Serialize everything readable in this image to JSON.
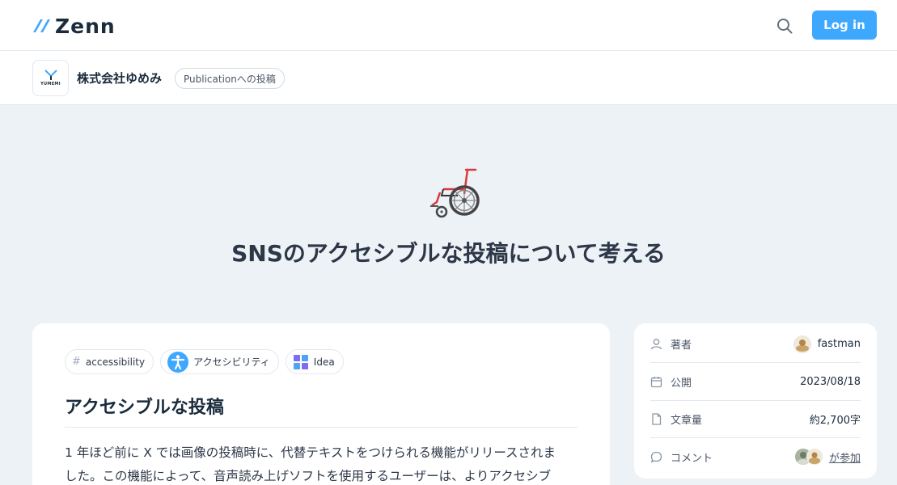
{
  "header": {
    "logo_text": "Zenn",
    "search_icon": "search-icon",
    "login_label": "Log in",
    "accent_color": "#3ea8ff"
  },
  "publication": {
    "logo_word": "YUMEMI",
    "name": "株式会社ゆめみ",
    "badge": "Publicationへの投稿"
  },
  "article": {
    "emoji_icon": "wheelchair-icon",
    "title": "SNSのアクセシブルな投稿について考える",
    "tags": [
      {
        "icon": "hash-icon",
        "label": "accessibility"
      },
      {
        "icon": "accessibility-icon",
        "label": "アクセシビリティ"
      },
      {
        "icon": "idea-icon",
        "label": "Idea"
      }
    ],
    "heading": "アクセシブルな投稿",
    "paragraph_line1": "1 年ほど前に X では画像の投稿時に、代替テキストをつけられる機能がリリースされま",
    "paragraph_line2": "した。この機能によって、音声読み上げソフトを使用するユーザーは、よりアクセシブ"
  },
  "sidebar": {
    "author_label": "著者",
    "author_name": "fastman",
    "published_label": "公開",
    "published_date": "2023/08/18",
    "length_label": "文章量",
    "length_value": "約2,700字",
    "comment_label": "コメント",
    "join_label": "が参加"
  }
}
